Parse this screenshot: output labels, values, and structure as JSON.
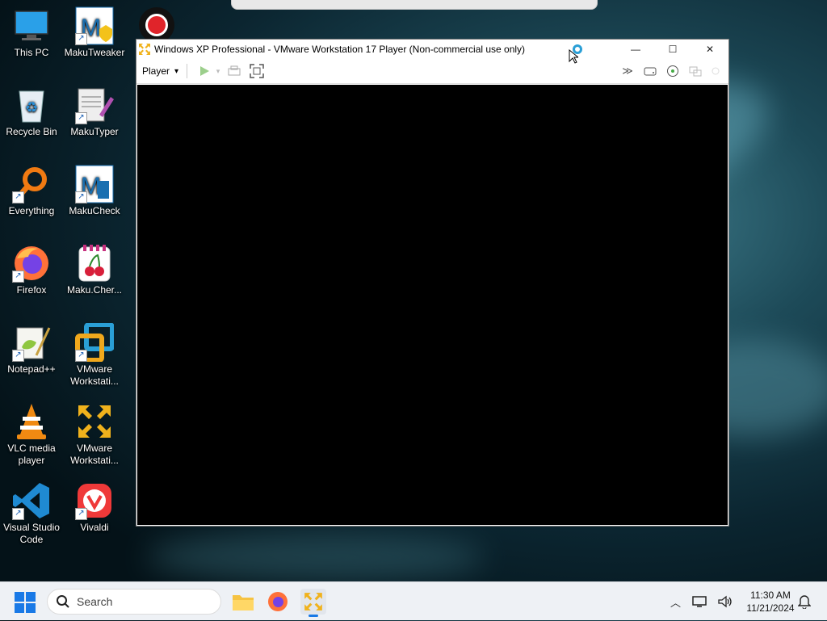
{
  "desktop": {
    "icons": [
      {
        "name": "this-pc",
        "label": "This PC"
      },
      {
        "name": "makutweaker",
        "label": "MakuTweaker"
      },
      {
        "name": "recycle-bin",
        "label": "Recycle Bin"
      },
      {
        "name": "makutyper",
        "label": "MakuTyper"
      },
      {
        "name": "everything",
        "label": "Everything"
      },
      {
        "name": "makucheck",
        "label": "MakuCheck"
      },
      {
        "name": "firefox",
        "label": "Firefox"
      },
      {
        "name": "maku-cherry",
        "label": "Maku.Cher..."
      },
      {
        "name": "notepadpp",
        "label": "Notepad++"
      },
      {
        "name": "vmware-workstation-1",
        "label": "VMware Workstati..."
      },
      {
        "name": "vlc",
        "label": "VLC media player"
      },
      {
        "name": "vmware-workstation-2",
        "label": "VMware Workstati..."
      },
      {
        "name": "vscode",
        "label": "Visual Studio Code"
      },
      {
        "name": "vivaldi",
        "label": "Vivaldi"
      }
    ]
  },
  "vm_window": {
    "title": "Windows XP Professional - VMware Workstation 17 Player (Non-commercial use only)",
    "menu_label": "Player",
    "menu_arrow": "▾",
    "controls": {
      "minimize": "—",
      "maximize": "☐",
      "close": "✕"
    }
  },
  "taskbar": {
    "search_placeholder": "Search",
    "time": "11:30 AM",
    "date": "11/21/2024"
  },
  "colors": {
    "accent": "#1979e6",
    "vmware_orange": "#f0a81c",
    "record_red": "#e0242a"
  }
}
